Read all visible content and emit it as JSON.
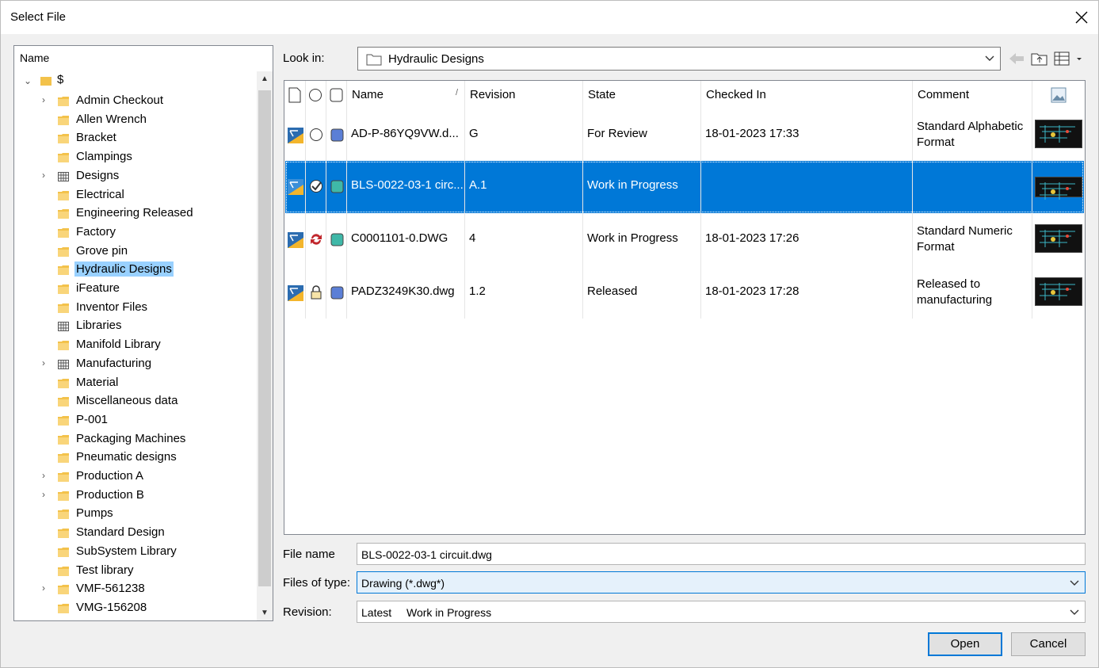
{
  "window": {
    "title": "Select File"
  },
  "tree": {
    "header": "Name",
    "root_label": "$",
    "items": [
      {
        "label": "Admin Checkout",
        "expand": true,
        "icon": "folder-icon"
      },
      {
        "label": "Allen Wrench",
        "expand": false,
        "icon": "folder-icon"
      },
      {
        "label": "Bracket",
        "expand": false,
        "icon": "folder-icon"
      },
      {
        "label": "Clampings",
        "expand": false,
        "icon": "folder-icon"
      },
      {
        "label": "Designs",
        "expand": true,
        "icon": "library-icon"
      },
      {
        "label": "Electrical",
        "expand": false,
        "icon": "folder-icon"
      },
      {
        "label": "Engineering Released",
        "expand": false,
        "icon": "folder-icon"
      },
      {
        "label": "Factory",
        "expand": false,
        "icon": "folder-icon"
      },
      {
        "label": "Grove pin",
        "expand": false,
        "icon": "folder-icon"
      },
      {
        "label": "Hydraulic Designs",
        "expand": false,
        "icon": "folder-icon",
        "selected": true
      },
      {
        "label": "iFeature",
        "expand": false,
        "icon": "folder-icon"
      },
      {
        "label": "Inventor Files",
        "expand": false,
        "icon": "folder-icon"
      },
      {
        "label": "Libraries",
        "expand": false,
        "icon": "library-icon"
      },
      {
        "label": "Manifold Library",
        "expand": false,
        "icon": "folder-icon"
      },
      {
        "label": "Manufacturing",
        "expand": true,
        "icon": "library-icon"
      },
      {
        "label": "Material",
        "expand": false,
        "icon": "folder-icon"
      },
      {
        "label": "Miscellaneous data",
        "expand": false,
        "icon": "folder-icon"
      },
      {
        "label": "P-001",
        "expand": false,
        "icon": "folder-icon"
      },
      {
        "label": "Packaging Machines",
        "expand": false,
        "icon": "folder-icon"
      },
      {
        "label": "Pneumatic designs",
        "expand": false,
        "icon": "folder-icon"
      },
      {
        "label": "Production A",
        "expand": true,
        "icon": "folder-icon"
      },
      {
        "label": "Production B",
        "expand": true,
        "icon": "folder-icon"
      },
      {
        "label": "Pumps",
        "expand": false,
        "icon": "folder-icon"
      },
      {
        "label": "Standard Design",
        "expand": false,
        "icon": "folder-icon"
      },
      {
        "label": "SubSystem Library",
        "expand": false,
        "icon": "folder-icon"
      },
      {
        "label": "Test library",
        "expand": false,
        "icon": "folder-icon"
      },
      {
        "label": "VMF-561238",
        "expand": true,
        "icon": "folder-icon"
      },
      {
        "label": "VMG-156208",
        "expand": false,
        "icon": "folder-icon"
      }
    ]
  },
  "lookin": {
    "label": "Look in:",
    "value": "Hydraulic Designs"
  },
  "columns": [
    "Name",
    "Revision",
    "State",
    "Checked In",
    "Comment"
  ],
  "files": [
    {
      "name": "AD-P-86YQ9VW.d...",
      "revision": "G",
      "state": "For Review",
      "checked_in": "18-01-2023 17:33",
      "comment": "Standard Alphabetic Format",
      "status_icon": "circle-icon",
      "state_color": "#5b7fd6",
      "selected": false
    },
    {
      "name": "BLS-0022-03-1 circ...",
      "revision": "A.1",
      "state": "Work in Progress",
      "checked_in": "",
      "comment": "",
      "status_icon": "checked-out-icon",
      "state_color": "#3fb8a8",
      "selected": true
    },
    {
      "name": "C0001101-0.DWG",
      "revision": "4",
      "state": "Work in Progress",
      "checked_in": "18-01-2023 17:26",
      "comment": "Standard Numeric Format",
      "status_icon": "sync-icon",
      "state_color": "#3fb8a8",
      "selected": false
    },
    {
      "name": "PADZ3249K30.dwg",
      "revision": "1.2",
      "state": "Released",
      "checked_in": "18-01-2023 17:28",
      "comment": "Released to manufacturing",
      "status_icon": "lock-icon",
      "state_color": "#5b7fd6",
      "selected": false
    }
  ],
  "form": {
    "filename_label": "File name",
    "filename_value": "BLS-0022-03-1 circuit.dwg",
    "filetype_label": "Files of type:",
    "filetype_value": "Drawing (*.dwg*)",
    "revision_label": "Revision:",
    "revision_value_a": "Latest",
    "revision_value_b": "Work in Progress"
  },
  "buttons": {
    "open": "Open",
    "cancel": "Cancel"
  }
}
